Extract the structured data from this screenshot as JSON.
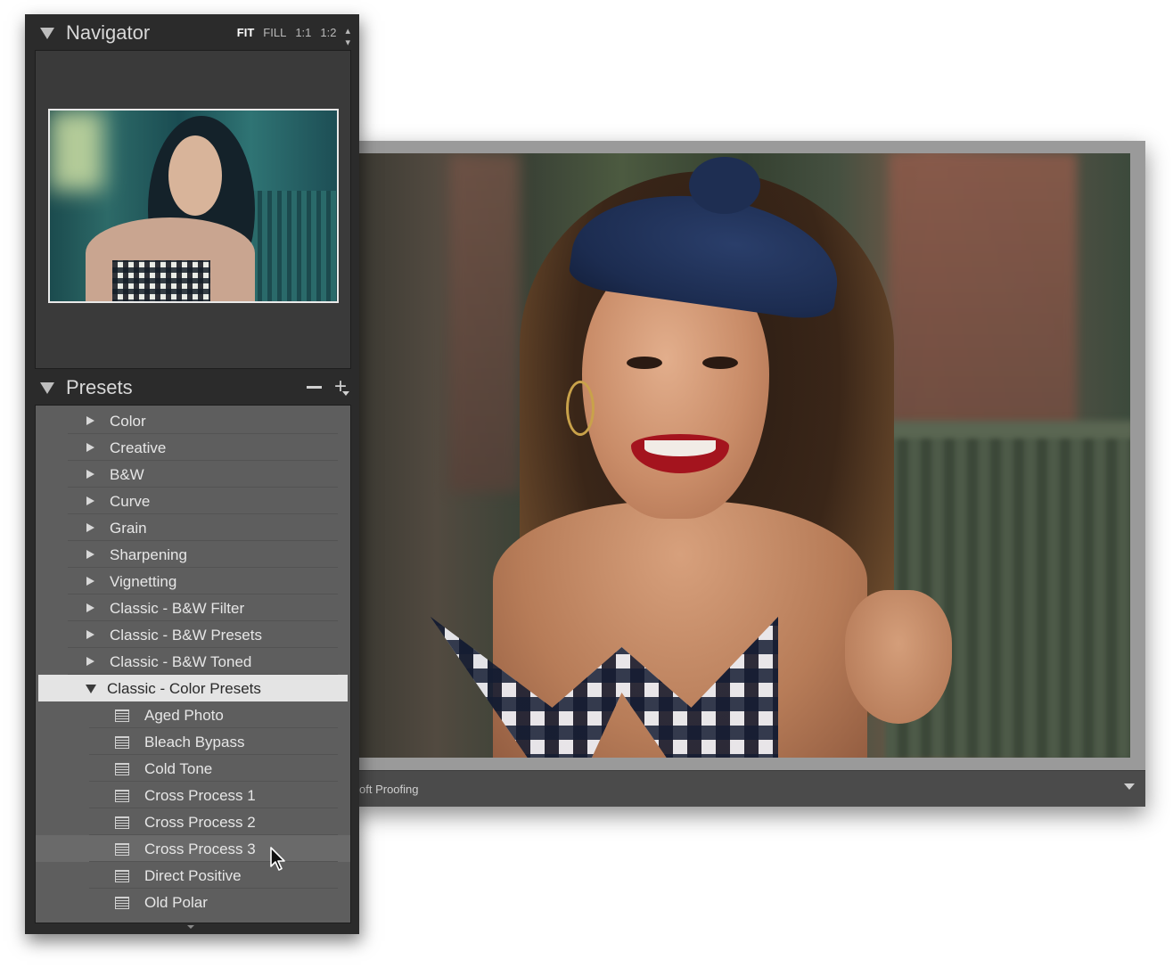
{
  "navigator": {
    "title": "Navigator",
    "zoom_options": [
      "FIT",
      "FILL",
      "1:1",
      "1:2"
    ],
    "active_zoom": "FIT"
  },
  "presets": {
    "title": "Presets",
    "folders": [
      "Color",
      "Creative",
      "B&W",
      "Curve",
      "Grain",
      "Sharpening",
      "Vignetting",
      "Classic - B&W Filter",
      "Classic - B&W Presets",
      "Classic - B&W Toned"
    ],
    "open_folder": "Classic - Color Presets",
    "items": [
      "Aged Photo",
      "Bleach Bypass",
      "Cold Tone",
      "Cross Process 1",
      "Cross Process 2",
      "Cross Process 3",
      "Direct Positive",
      "Old Polar"
    ],
    "hovered_item": "Cross Process 3"
  },
  "toolbar": {
    "soft_proofing_label": "oft Proofing"
  },
  "icons": {
    "collapse": "disclosure-triangle-icon",
    "folder": "folder-arrow-icon",
    "preset": "preset-list-icon",
    "add": "plus-icon",
    "remove": "minus-icon",
    "cursor": "arrow-cursor-icon"
  },
  "colors": {
    "panel_bg": "#2b2b2b",
    "list_bg": "#5e5e5e",
    "selected_row": "#e4e4e4",
    "window_frame": "#9a9a9a"
  }
}
